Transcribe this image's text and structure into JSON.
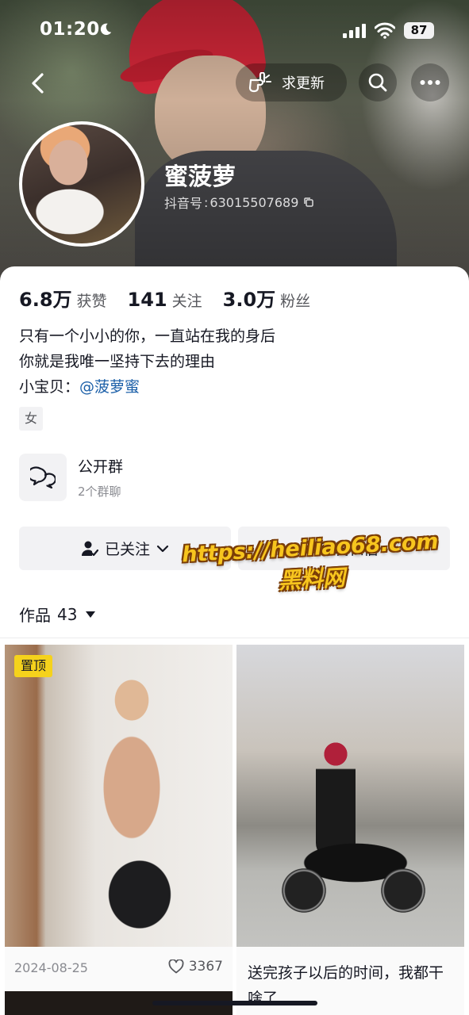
{
  "status_bar": {
    "time": "01:20",
    "battery": "87"
  },
  "header": {
    "update_label": "求更新",
    "nickname": "蜜菠萝",
    "douyin_id_label": "抖音号",
    "douyin_id_sep": ":",
    "douyin_id": "63015507689"
  },
  "stats": [
    {
      "value": "6.8万",
      "label": "获赞"
    },
    {
      "value": "141",
      "label": "关注"
    },
    {
      "value": "3.0万",
      "label": "粉丝"
    }
  ],
  "bio": {
    "line1": "只有一个小小的你，一直站在我的身后",
    "line2": "你就是我唯一坚持下去的理由",
    "line3_prefix": "小宝贝：",
    "line3_mention": "@菠萝蜜"
  },
  "gender_tag": "女",
  "group": {
    "title": "公开群",
    "subtitle": "2个群聊"
  },
  "actions": {
    "followed_label": "已关注",
    "message_label": "发私信"
  },
  "watermark": {
    "line1": "https://heiliao68.com",
    "line2": "黑料网"
  },
  "works": {
    "label": "作品",
    "count": "43"
  },
  "grid": [
    {
      "pin_label": "置顶",
      "date": "2024-08-25",
      "likes": "3367"
    },
    {
      "title": "送完孩子以后的时间，我都干啥了"
    }
  ]
}
